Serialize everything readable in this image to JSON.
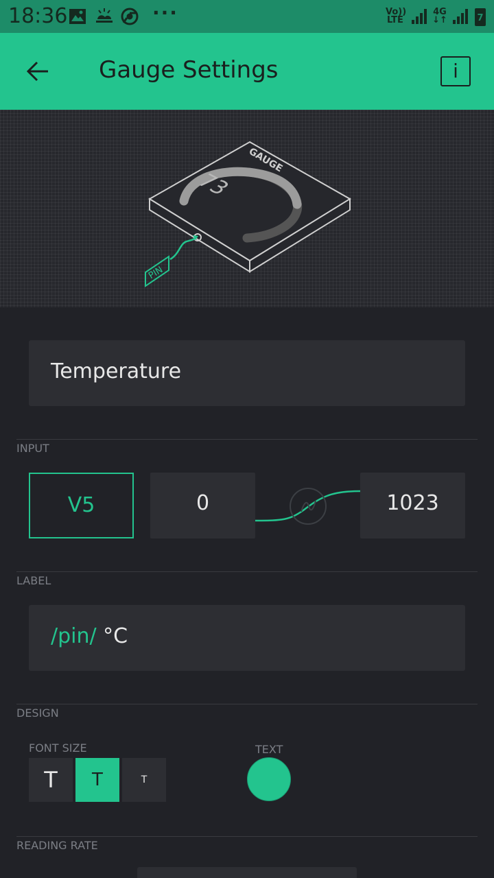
{
  "status_bar": {
    "time": "18:36",
    "more": "···",
    "volte_line1": "Vo))",
    "volte_line2": "LTE",
    "network": "4G",
    "battery": "7",
    "icons": [
      "image-icon",
      "weather-icon",
      "chrome-icon",
      "signal-icon",
      "signal-icon",
      "battery-icon"
    ]
  },
  "app_bar": {
    "title": "Gauge Settings",
    "info_label": "i",
    "back_icon": "arrow-left-icon"
  },
  "hero": {
    "widget_label": "GAUGE",
    "gauge_value": "73",
    "pin_label": "PIN",
    "gauge_fill": 0.73
  },
  "name_field": {
    "value": "Temperature"
  },
  "input": {
    "section_label": "INPUT",
    "pin": "V5",
    "min": "0",
    "max": "1023"
  },
  "label": {
    "section_label": "LABEL",
    "pin_token": "/pin/",
    "unit": " °C"
  },
  "design": {
    "section_label": "DESIGN",
    "font_size_label": "FONT SIZE",
    "font_sizes": [
      "T",
      "T",
      "T"
    ],
    "selected_font_size": 1,
    "text_color_label": "TEXT",
    "text_color": "#23c48e"
  },
  "reading_rate": {
    "section_label": "READING RATE"
  },
  "colors": {
    "accent": "#23c48e",
    "background": "#212227",
    "field": "#2d2e33",
    "status_bar": "#1d8c68"
  }
}
